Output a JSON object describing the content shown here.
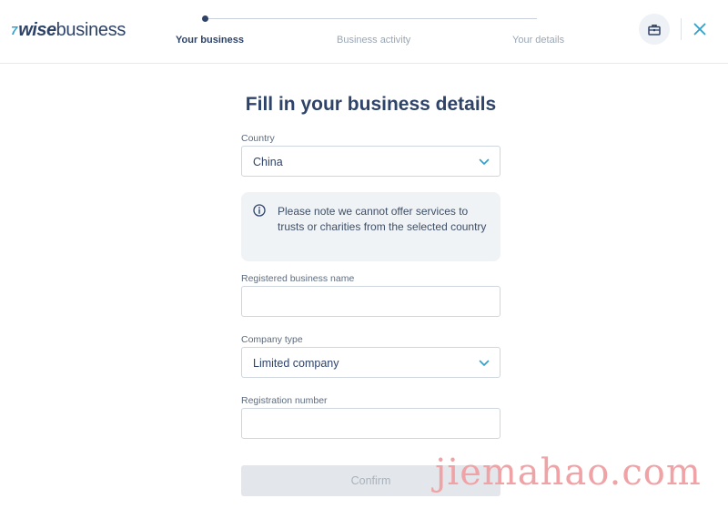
{
  "header": {
    "logo_mark": "7",
    "logo_wise": "wise",
    "logo_business": "business",
    "steps": [
      {
        "label": "Your business",
        "active": true
      },
      {
        "label": "Business activity",
        "active": false
      },
      {
        "label": "Your details",
        "active": false
      }
    ],
    "briefcase_icon": "briefcase-icon",
    "close_icon": "close-icon"
  },
  "form": {
    "title": "Fill in your business details",
    "country": {
      "label": "Country",
      "value": "China"
    },
    "notice": {
      "text": "Please note we cannot offer services to trusts or charities from the selected country",
      "icon": "info-icon"
    },
    "business_name": {
      "label": "Registered business name",
      "value": ""
    },
    "company_type": {
      "label": "Company type",
      "value": "Limited company"
    },
    "registration_number": {
      "label": "Registration number",
      "value": ""
    },
    "confirm_label": "Confirm"
  },
  "watermark": "jiemahao.com",
  "colors": {
    "navy": "#2e4369",
    "accent": "#2ea1cc",
    "notice_bg": "#f0f3f6",
    "disabled_button": "#e3e6ea",
    "watermark": "#f0a3a6"
  }
}
